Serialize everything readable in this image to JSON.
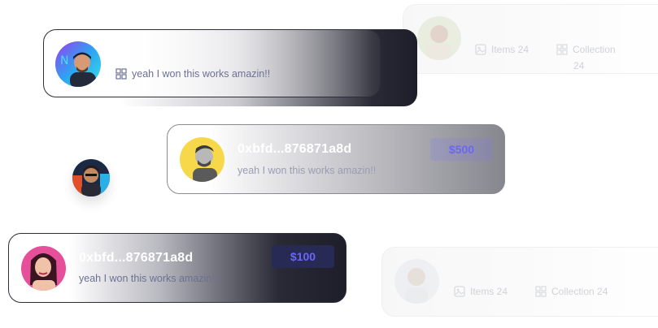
{
  "cards": {
    "top_right": {
      "items_label": "Items 24",
      "collection_label": "Collection",
      "collection_count": "24"
    },
    "top_left": {
      "message": "yeah I won this works amazin!!"
    },
    "middle": {
      "address": "0xbfd...876871a8d",
      "price": "$500",
      "message": "yeah I won this works amazin!!"
    },
    "bottom_left": {
      "address": "0xbfd...876871a8d",
      "price": "$100",
      "message": "yeah I won this works amazin!!"
    },
    "bottom_right": {
      "items_label": "Items 24",
      "collection_label": "Collection 24"
    }
  },
  "colors": {
    "accent": "#6b67f2",
    "dark_card": "#1e1e2a",
    "muted_text": "#6c7193"
  },
  "icons": [
    "collection-icon",
    "image-icon"
  ]
}
